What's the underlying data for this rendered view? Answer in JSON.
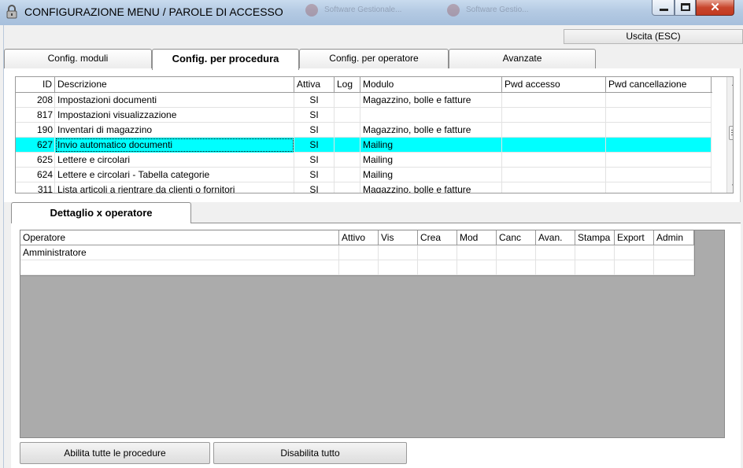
{
  "window": {
    "title": "CONFIGURAZIONE MENU / PAROLE DI ACCESSO",
    "app_icon": "lock-icon",
    "background_tabs": [
      "Software Gestionale...",
      "Software Gestio..."
    ],
    "controls": {
      "minimize": "minimize-icon",
      "maximize": "maximize-icon",
      "close": "close-icon"
    }
  },
  "toolbar": {
    "exit_label": "Uscita (ESC)"
  },
  "tabs": [
    {
      "label": "Config. moduli",
      "active": false
    },
    {
      "label": "Config. per procedura",
      "active": true
    },
    {
      "label": "Config. per operatore",
      "active": false
    },
    {
      "label": "Avanzate",
      "active": false
    }
  ],
  "procedures": {
    "columns": [
      "ID",
      "Descrizione",
      "Attiva",
      "Log",
      "Modulo",
      "Pwd accesso",
      "Pwd cancellazione"
    ],
    "rows": [
      {
        "id": "208",
        "desc": "Impostazioni documenti",
        "attiva": "SI",
        "log": "",
        "modulo": "Magazzino, bolle e fatture",
        "pwd_acc": "",
        "pwd_canc": "",
        "selected": false
      },
      {
        "id": "817",
        "desc": "Impostazioni visualizzazione",
        "attiva": "SI",
        "log": "",
        "modulo": "",
        "pwd_acc": "",
        "pwd_canc": "",
        "selected": false
      },
      {
        "id": "190",
        "desc": "Inventari di magazzino",
        "attiva": "SI",
        "log": "",
        "modulo": "Magazzino, bolle e fatture",
        "pwd_acc": "",
        "pwd_canc": "",
        "selected": false
      },
      {
        "id": "627",
        "desc": "Invio automatico documenti",
        "attiva": "SI",
        "log": "",
        "modulo": "Mailing",
        "pwd_acc": "",
        "pwd_canc": "",
        "selected": true
      },
      {
        "id": "625",
        "desc": "Lettere e circolari",
        "attiva": "SI",
        "log": "",
        "modulo": "Mailing",
        "pwd_acc": "",
        "pwd_canc": "",
        "selected": false
      },
      {
        "id": "624",
        "desc": "Lettere e circolari - Tabella categorie",
        "attiva": "SI",
        "log": "",
        "modulo": "Mailing",
        "pwd_acc": "",
        "pwd_canc": "",
        "selected": false
      },
      {
        "id": "311",
        "desc": "Lista articoli a rientrare da clienti o fornitori",
        "attiva": "SI",
        "log": "",
        "modulo": "Magazzino, bolle e fatture",
        "pwd_acc": "",
        "pwd_canc": "",
        "selected": false
      }
    ],
    "selection_color": "#00ffff"
  },
  "detail": {
    "tab_label": "Dettaglio x operatore",
    "columns": [
      "Operatore",
      "Attivo",
      "Vis",
      "Crea",
      "Mod",
      "Canc",
      "Avan.",
      "Stampa",
      "Export",
      "Admin"
    ],
    "rows": [
      {
        "operatore": "Amministratore",
        "attivo": "",
        "vis": "",
        "crea": "",
        "mod": "",
        "canc": "",
        "avan": "",
        "stampa": "",
        "export": "",
        "admin": ""
      }
    ]
  },
  "actions": {
    "enable_all": "Abilita tutte le procedure",
    "disable_all": "Disabilita tutto"
  }
}
